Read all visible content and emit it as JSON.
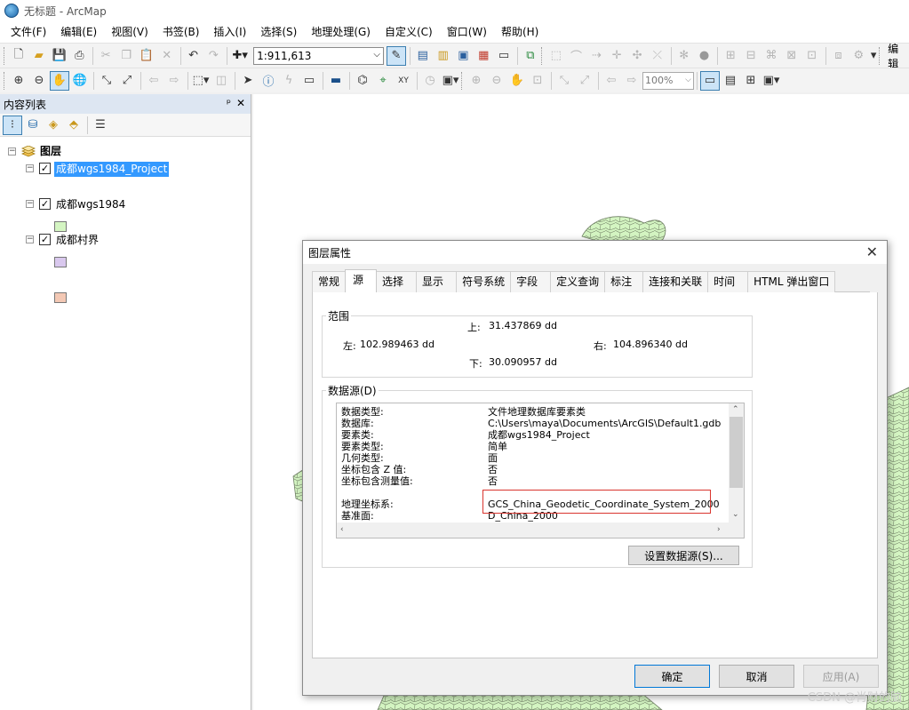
{
  "window": {
    "title": "无标题 - ArcMap"
  },
  "menu": [
    "文件(F)",
    "编辑(E)",
    "视图(V)",
    "书签(B)",
    "插入(I)",
    "选择(S)",
    "地理处理(G)",
    "自定义(C)",
    "窗口(W)",
    "帮助(H)"
  ],
  "toolbar": {
    "scale_value": "1:911,613",
    "zoom_value": "100%",
    "editor_label": "编辑"
  },
  "toc": {
    "title": "内容列表",
    "pin": "ᵖ",
    "root_label": "图层",
    "layers": [
      {
        "name": "成都wgs1984_Project",
        "checked": true,
        "selected": true,
        "swatch": "#d4f5c2"
      },
      {
        "name": "成都wgs1984",
        "checked": true,
        "selected": false,
        "swatch": "#d9c8ee"
      },
      {
        "name": "成都村界",
        "checked": true,
        "selected": false,
        "swatch": "#f3c8b4"
      }
    ]
  },
  "dialog": {
    "title": "图层属性",
    "tabs": [
      "常规",
      "源",
      "选择",
      "显示",
      "符号系统",
      "字段",
      "定义查询",
      "标注",
      "连接和关联",
      "时间",
      "HTML 弹出窗口"
    ],
    "active_tab": "源",
    "extent": {
      "label": "范围",
      "top_label": "上:",
      "top": "31.437869 dd",
      "left_label": "左:",
      "left": "102.989463 dd",
      "right_label": "右:",
      "right": "104.896340 dd",
      "bottom_label": "下:",
      "bottom": "30.090957 dd"
    },
    "datasource": {
      "label": "数据源(D)",
      "rows": [
        {
          "key": "数据类型:",
          "value": "文件地理数据库要素类"
        },
        {
          "key": "数据库:",
          "value": "C:\\Users\\maya\\Documents\\ArcGIS\\Default1.gdb"
        },
        {
          "key": "要素类:",
          "value": "成都wgs1984_Project"
        },
        {
          "key": "要素类型:",
          "value": "简单"
        },
        {
          "key": "几何类型:",
          "value": "面"
        },
        {
          "key": "坐标包含 Z 值:",
          "value": "否"
        },
        {
          "key": "坐标包含测量值:",
          "value": "否"
        },
        {
          "key": "地理坐标系:",
          "value": "GCS_China_Geodetic_Coordinate_System_2000"
        },
        {
          "key": "基准面:",
          "value": "D_China_2000"
        }
      ],
      "set_button": "设置数据源(S)..."
    },
    "ok": "确定",
    "cancel": "取消",
    "apply": "应用(A)"
  },
  "watermark": "CSDN @肖财的脑"
}
